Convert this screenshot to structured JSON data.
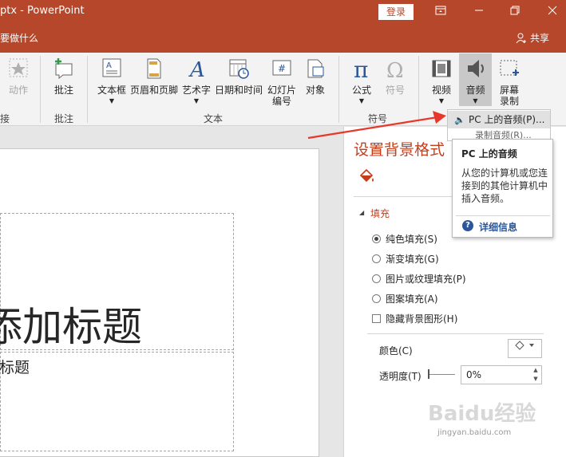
{
  "titlebar": {
    "title": "ptx - PowerPoint",
    "login": "登录",
    "tell_me": "要做什么",
    "share": "共享"
  },
  "ribbon": {
    "groups": [
      {
        "label": "接",
        "buttons": [
          {
            "label": "动作"
          }
        ]
      },
      {
        "label": "批注",
        "buttons": [
          {
            "label": "批注"
          }
        ]
      },
      {
        "label": "文本",
        "buttons": [
          {
            "label": "文本框"
          },
          {
            "label": "页眉和页脚"
          },
          {
            "label": "艺术字"
          },
          {
            "label": "日期和时间"
          },
          {
            "label": "幻灯片\n编号"
          },
          {
            "label": "对象"
          }
        ]
      },
      {
        "label": "符号",
        "buttons": [
          {
            "label": "公式"
          },
          {
            "label": "符号"
          }
        ]
      },
      {
        "label": "",
        "buttons": [
          {
            "label": "视频"
          },
          {
            "label": "音频"
          },
          {
            "label": "屏幕\n录制"
          }
        ]
      }
    ]
  },
  "slide": {
    "title_placeholder": "添加标题",
    "subtitle_placeholder": "副标题"
  },
  "pane": {
    "title": "设置背景格式",
    "section": "填充",
    "options": [
      {
        "label": "纯色填充(S)",
        "selected": true
      },
      {
        "label": "渐变填充(G)",
        "selected": false
      },
      {
        "label": "图片或纹理填充(P)",
        "selected": false
      },
      {
        "label": "图案填充(A)",
        "selected": false
      }
    ],
    "hide_bg": "隐藏背景图形(H)",
    "color_label": "颜色(C)",
    "transparency_label": "透明度(T)",
    "transparency_value": "0%"
  },
  "menu": {
    "item1": "PC 上的音频(P)...",
    "item2": "录制音频(R)..."
  },
  "tooltip": {
    "title": "PC 上的音频",
    "body": "从您的计算机或您连接到的其他计算机中插入音频。",
    "help": "详细信息"
  },
  "watermark": {
    "brand": "Baidu经验",
    "url": "jingyan.baidu.com"
  },
  "colors": {
    "accent": "#b7472a",
    "pane_title": "#c43e1c",
    "arrow": "#e8372a",
    "help": "#2b579a"
  }
}
